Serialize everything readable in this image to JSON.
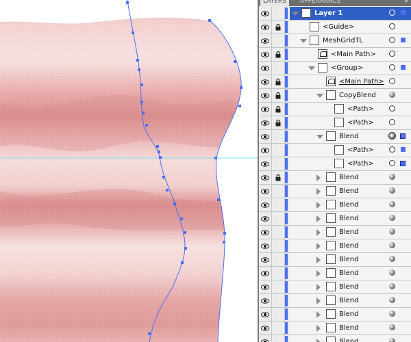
{
  "panel": {
    "tabs": [
      {
        "label": "LAYERS",
        "active": true
      },
      {
        "label": "APPEARANCE",
        "active": false
      }
    ],
    "menu_icon": "double-chevron-icon",
    "accent_color": "#4a6ef5",
    "selection_color": "#2f5fc6",
    "rows": [
      {
        "label": "Layer 1",
        "lock": false,
        "indent": 0,
        "tri": "open",
        "thumb": "box",
        "target": "ring",
        "selected_marker": "square",
        "selected": true
      },
      {
        "label": "<Guide>",
        "lock": true,
        "indent": 1,
        "tri": "none",
        "thumb": "box",
        "target": "ring",
        "selected_marker": "none"
      },
      {
        "label": "MeshGridTL",
        "lock": false,
        "indent": 1,
        "tri": "open",
        "thumb": "box",
        "target": "ring",
        "selected_marker": "square"
      },
      {
        "label": "<Main Path>",
        "lock": true,
        "indent": 2,
        "tri": "none",
        "thumb": "path",
        "target": "ring",
        "selected_marker": "none"
      },
      {
        "label": "<Group>",
        "lock": false,
        "indent": 2,
        "tri": "open",
        "thumb": "box",
        "target": "ring",
        "selected_marker": "square"
      },
      {
        "label": "<Main Path>",
        "lock": true,
        "indent": 3,
        "tri": "none",
        "thumb": "path",
        "target": "ring",
        "selected_marker": "none",
        "underline": true
      },
      {
        "label": "CopyBlend",
        "lock": true,
        "indent": 3,
        "tri": "open",
        "thumb": "box",
        "target": "filled",
        "selected_marker": "none"
      },
      {
        "label": "<Path>",
        "lock": true,
        "indent": 4,
        "tri": "none",
        "thumb": "box",
        "target": "ring",
        "selected_marker": "none"
      },
      {
        "label": "<Path>",
        "lock": true,
        "indent": 4,
        "tri": "none",
        "thumb": "box",
        "target": "ring",
        "selected_marker": "none"
      },
      {
        "label": "Blend",
        "lock": false,
        "indent": 3,
        "tri": "open",
        "thumb": "box",
        "target": "double",
        "selected_marker": "outline"
      },
      {
        "label": "<Path>",
        "lock": false,
        "indent": 4,
        "tri": "none",
        "thumb": "box",
        "target": "ring",
        "selected_marker": "square"
      },
      {
        "label": "<Path>",
        "lock": false,
        "indent": 4,
        "tri": "none",
        "thumb": "box",
        "target": "ring",
        "selected_marker": "outline"
      },
      {
        "label": "Blend",
        "lock": true,
        "indent": 3,
        "tri": "closed",
        "thumb": "box",
        "target": "filled",
        "selected_marker": "none"
      },
      {
        "label": "Blend",
        "lock": false,
        "indent": 3,
        "tri": "closed",
        "thumb": "box",
        "target": "filled",
        "selected_marker": "none"
      },
      {
        "label": "Blend",
        "lock": false,
        "indent": 3,
        "tri": "closed",
        "thumb": "box",
        "target": "filled",
        "selected_marker": "none"
      },
      {
        "label": "Blend",
        "lock": false,
        "indent": 3,
        "tri": "closed",
        "thumb": "box",
        "target": "filled",
        "selected_marker": "none"
      },
      {
        "label": "Blend",
        "lock": false,
        "indent": 3,
        "tri": "closed",
        "thumb": "box",
        "target": "filled",
        "selected_marker": "none"
      },
      {
        "label": "Blend",
        "lock": false,
        "indent": 3,
        "tri": "closed",
        "thumb": "box",
        "target": "filled",
        "selected_marker": "none"
      },
      {
        "label": "Blend",
        "lock": false,
        "indent": 3,
        "tri": "closed",
        "thumb": "box",
        "target": "filled",
        "selected_marker": "none"
      },
      {
        "label": "Blend",
        "lock": false,
        "indent": 3,
        "tri": "closed",
        "thumb": "box",
        "target": "filled",
        "selected_marker": "none"
      },
      {
        "label": "Blend",
        "lock": false,
        "indent": 3,
        "tri": "closed",
        "thumb": "box",
        "target": "filled",
        "selected_marker": "none"
      },
      {
        "label": "Blend",
        "lock": false,
        "indent": 3,
        "tri": "closed",
        "thumb": "box",
        "target": "filled",
        "selected_marker": "none"
      },
      {
        "label": "Blend",
        "lock": false,
        "indent": 3,
        "tri": "closed",
        "thumb": "box",
        "target": "filled",
        "selected_marker": "none"
      },
      {
        "label": "Blend",
        "lock": false,
        "indent": 3,
        "tri": "closed",
        "thumb": "box",
        "target": "filled",
        "selected_marker": "none"
      },
      {
        "label": "Blend",
        "lock": false,
        "indent": 3,
        "tri": "closed",
        "thumb": "box",
        "target": "filled",
        "selected_marker": "none"
      }
    ]
  },
  "canvas": {
    "guide_color": "#6fe0ef",
    "path_color": "#4a6ef5",
    "fabric_light": "#f6dcdb",
    "fabric_dark": "#d27f7e"
  }
}
